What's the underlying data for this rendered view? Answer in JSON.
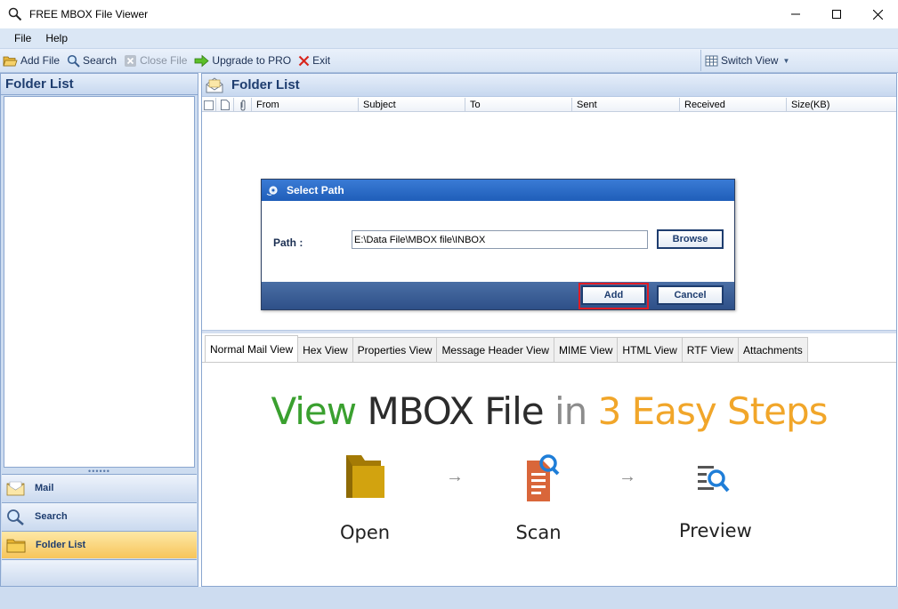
{
  "window": {
    "title": "FREE MBOX File Viewer",
    "app_icon": "magnifier-icon",
    "controls": [
      "minimize-icon",
      "maximize-icon",
      "close-icon"
    ]
  },
  "menu": [
    "File",
    "Help"
  ],
  "toolbar": {
    "add_file": "Add File",
    "search": "Search",
    "close_file": "Close File",
    "upgrade": "Upgrade to PRO",
    "exit": "Exit",
    "switch_view": "Switch View"
  },
  "left_pane": {
    "title": "Folder List",
    "nav": [
      {
        "label": "Mail",
        "icon": "envelope-icon"
      },
      {
        "label": "Search",
        "icon": "magnifier-icon"
      },
      {
        "label": "Folder List",
        "icon": "folder-icon",
        "active": true
      }
    ]
  },
  "right_pane": {
    "title": "Folder List",
    "columns": [
      "From",
      "Subject",
      "To",
      "Sent",
      "Received",
      "Size(KB)"
    ]
  },
  "tabs": [
    {
      "label": "Normal Mail View",
      "active": true
    },
    {
      "label": "Hex View"
    },
    {
      "label": "Properties View"
    },
    {
      "label": "Message Header View"
    },
    {
      "label": "MIME View"
    },
    {
      "label": "HTML View"
    },
    {
      "label": "RTF View"
    },
    {
      "label": "Attachments"
    }
  ],
  "preview": {
    "headline": {
      "part1": "View",
      "part2": "MBOX File",
      "part3": "in",
      "part4": "3 Easy Steps"
    },
    "steps": [
      {
        "label": "Open",
        "icon": "folder-icon"
      },
      {
        "label": "Scan",
        "icon": "document-search-icon"
      },
      {
        "label": "Preview",
        "icon": "list-search-icon"
      }
    ],
    "arrow": "→"
  },
  "dialog": {
    "title": "Select Path",
    "path_label": "Path :",
    "path_value": "E:\\Data File\\MBOX file\\INBOX",
    "browse": "Browse",
    "add": "Add",
    "cancel": "Cancel"
  },
  "colors": {
    "headline_green": "#3aa02f",
    "headline_orange": "#f1a62a",
    "highlight_red": "#e01c24",
    "dialog_title": "#1f5eb9"
  }
}
